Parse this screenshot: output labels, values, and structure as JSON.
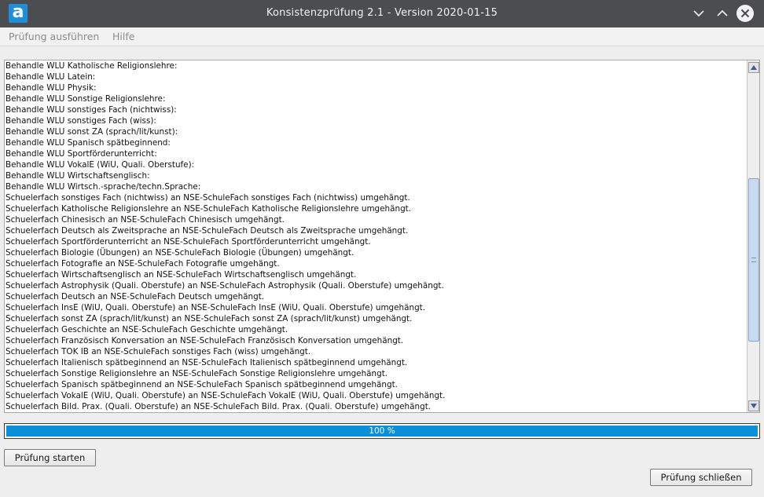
{
  "window": {
    "title": "Konsistenzprüfung 2.1 - Version 2020-01-15",
    "logo_letter": "a",
    "icons": {
      "minimize": "chevron-down-icon",
      "maximize": "chevron-up-icon",
      "close": "close-circle-icon"
    },
    "colors": {
      "titlebar": "#4b4d50",
      "logo": "#1e8fd8"
    }
  },
  "menu": {
    "items": [
      "Prüfung ausführen",
      "Hilfe"
    ]
  },
  "log": {
    "lines": [
      "Behandle WLU Katholische Religionslehre:",
      "Behandle WLU Latein:",
      "Behandle WLU Physik:",
      "Behandle WLU Sonstige Religionslehre:",
      "Behandle WLU sonstiges Fach (nichtwiss):",
      "Behandle WLU sonstiges Fach (wiss):",
      "Behandle WLU sonst ZA (sprach/lit/kunst):",
      "Behandle WLU Spanisch spätbeginnend:",
      "Behandle WLU Sportförderunterricht:",
      "Behandle WLU VokalE (WiU, Quali. Oberstufe):",
      "Behandle WLU Wirtschaftsenglisch:",
      "Behandle WLU Wirtsch.-sprache/techn.Sprache:",
      "Schuelerfach sonstiges Fach (nichtwiss) an NSE-SchuleFach sonstiges Fach (nichtwiss) umgehängt.",
      "Schuelerfach Katholische Religionslehre an NSE-SchuleFach Katholische Religionslehre umgehängt.",
      "Schuelerfach Chinesisch an NSE-SchuleFach Chinesisch umgehängt.",
      "Schuelerfach Deutsch als Zweitsprache an NSE-SchuleFach Deutsch als Zweitsprache umgehängt.",
      "Schuelerfach Sportförderunterricht an NSE-SchuleFach Sportförderunterricht umgehängt.",
      "Schuelerfach Biologie (Übungen) an NSE-SchuleFach Biologie (Übungen) umgehängt.",
      "Schuelerfach Fotografie an NSE-SchuleFach Fotografie umgehängt.",
      "Schuelerfach Wirtschaftsenglisch an NSE-SchuleFach Wirtschaftsenglisch umgehängt.",
      "Schuelerfach Astrophysik (Quali. Oberstufe) an NSE-SchuleFach Astrophysik (Quali. Oberstufe) umgehängt.",
      "Schuelerfach Deutsch an NSE-SchuleFach Deutsch umgehängt.",
      "Schuelerfach InsE (WiU, Quali. Oberstufe) an NSE-SchuleFach InsE (WiU, Quali. Oberstufe) umgehängt.",
      "Schuelerfach sonst ZA (sprach/lit/kunst) an NSE-SchuleFach sonst ZA (sprach/lit/kunst) umgehängt.",
      "Schuelerfach Geschichte an NSE-SchuleFach Geschichte umgehängt.",
      "Schuelerfach Französisch Konversation an NSE-SchuleFach Französisch Konversation umgehängt.",
      "Schuelerfach TOK IB an NSE-SchuleFach sonstiges Fach (wiss) umgehängt.",
      "Schuelerfach Italienisch spätbeginnend an NSE-SchuleFach Italienisch spätbeginnend umgehängt.",
      "Schuelerfach Sonstige Religionslehre an NSE-SchuleFach Sonstige Religionslehre umgehängt.",
      "Schuelerfach Spanisch spätbeginnend an NSE-SchuleFach Spanisch spätbeginnend umgehängt.",
      "Schuelerfach VokalE (WiU, Quali. Oberstufe) an NSE-SchuleFach VokalE (WiU, Quali. Oberstufe) umgehängt.",
      "Schuelerfach Bild. Prax. (Quali. Oberstufe) an NSE-SchuleFach Bild. Prax. (Quali. Oberstufe) umgehängt."
    ]
  },
  "progress": {
    "value_percent": 100,
    "label": "100 %",
    "color": "#0b8fd8"
  },
  "buttons": {
    "start": "Prüfung starten",
    "close": "Prüfung schließen"
  }
}
